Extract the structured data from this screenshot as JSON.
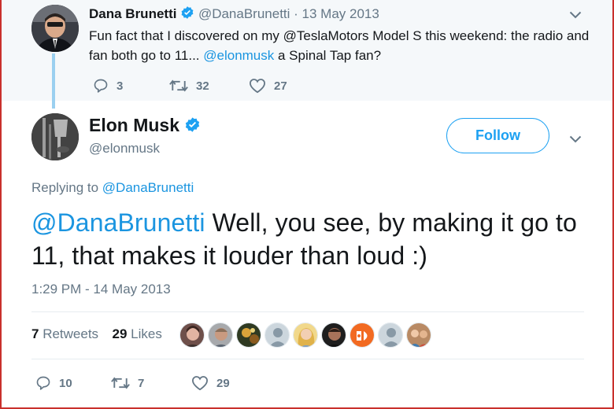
{
  "parent_tweet": {
    "name": "Dana Brunetti",
    "handle": "@DanaBrunetti",
    "separator": " · ",
    "date": "13 May 2013",
    "text_before": "Fun fact that I discovered on my @TeslaMotors Model S this weekend: the radio and fan both go to 11... ",
    "mention": "@elonmusk",
    "text_after": " a Spinal Tap fan?",
    "replies": "3",
    "retweets": "32",
    "likes": "27"
  },
  "tweet": {
    "name": "Elon Musk",
    "handle": "@elonmusk",
    "follow_label": "Follow",
    "replying_prefix": "Replying to ",
    "replying_to": "@DanaBrunetti",
    "mention": "@DanaBrunetti",
    "text": " Well, you see, by making it go to 11, that makes it louder than loud :)",
    "timestamp": "1:29 PM - 14 May 2013",
    "retweet_count": "7",
    "retweet_label": " Retweets",
    "like_count": "29",
    "like_label": " Likes",
    "replies": "10",
    "retweets": "7",
    "likes": "29"
  },
  "colors": {
    "accent": "#1da1f2",
    "link": "#1b95e0",
    "muted": "#657786",
    "parent_background": "#f5f8fa",
    "thread_line": "#9ad0f0"
  },
  "icons": [
    "verified-badge-icon",
    "chevron-down-icon",
    "reply-icon",
    "retweet-icon",
    "like-icon"
  ]
}
